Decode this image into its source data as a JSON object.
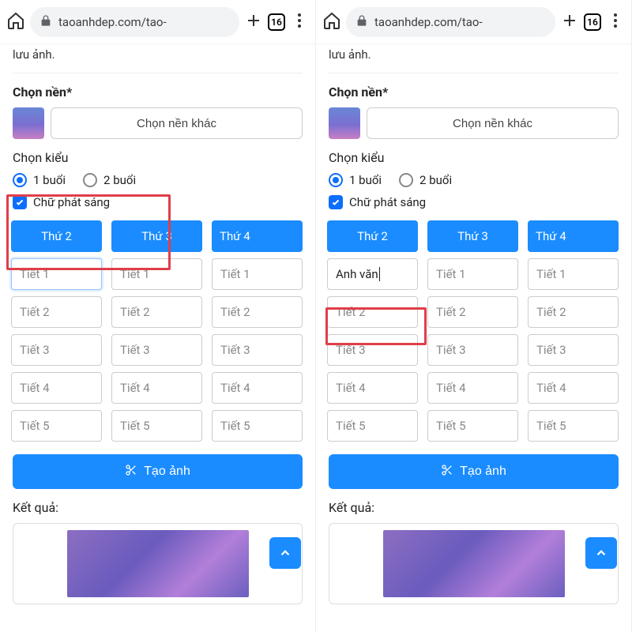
{
  "chrome": {
    "url": "taoanhdep.com/tao-",
    "tab_count": "16"
  },
  "page": {
    "truncated_top": "lưu ảnh.",
    "bg_label": "Chọn nền*",
    "bg_button": "Chọn nền khác",
    "style_label": "Chọn kiểu",
    "radio1": "1 buổi",
    "radio2": "2 buổi",
    "check_label": "Chữ phát sáng",
    "days": [
      "Thứ 2",
      "Thứ 3",
      "Thứ 4"
    ],
    "periods": [
      "Tiết 1",
      "Tiết 2",
      "Tiết 3",
      "Tiết 4",
      "Tiết 5"
    ],
    "create": "Tạo ảnh",
    "result_label": "Kết quả:"
  },
  "right": {
    "first_cell_value": "Anh văn"
  }
}
